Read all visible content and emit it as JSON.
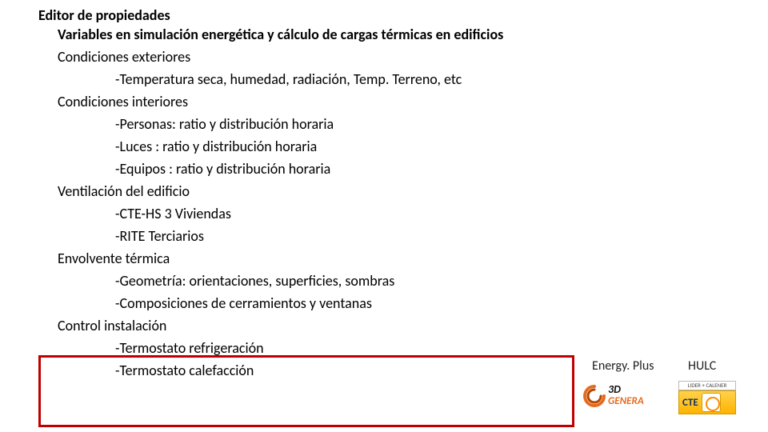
{
  "title": "Editor de propiedades",
  "subtitle": "Variables en simulación energética y cálculo de cargas térmicas en edificios",
  "sections": {
    "ext_hdr": "Condiciones exteriores",
    "ext_1": "-Temperatura seca, humedad, radiación, Temp. Terreno, etc",
    "int_hdr": "Condiciones interiores",
    "int_1": "-Personas: ratio y distribución horaria",
    "int_2": "-Luces : ratio y distribución horaria",
    "int_3": "-Equipos : ratio y distribución horaria",
    "vent_hdr": "Ventilación del edificio",
    "vent_1": "-CTE-HS 3 Viviendas",
    "vent_2": "-RITE Terciarios",
    "env_hdr": "Envolvente térmica",
    "env_1": "-Geometría: orientaciones, superficies, sombras",
    "env_2": "-Composiciones de cerramientos y ventanas",
    "ctrl_hdr": "Control instalación",
    "ctrl_1": "-Termostato refrigeración",
    "ctrl_2": "-Termostato calefacción"
  },
  "labels": {
    "energyplus": "Energy. Plus",
    "hulc": "HULC"
  },
  "logo3d": {
    "line1": "3D",
    "line2": "GENERA"
  },
  "logocte": {
    "top": "LIDER + CALENER",
    "main": "CTE"
  }
}
